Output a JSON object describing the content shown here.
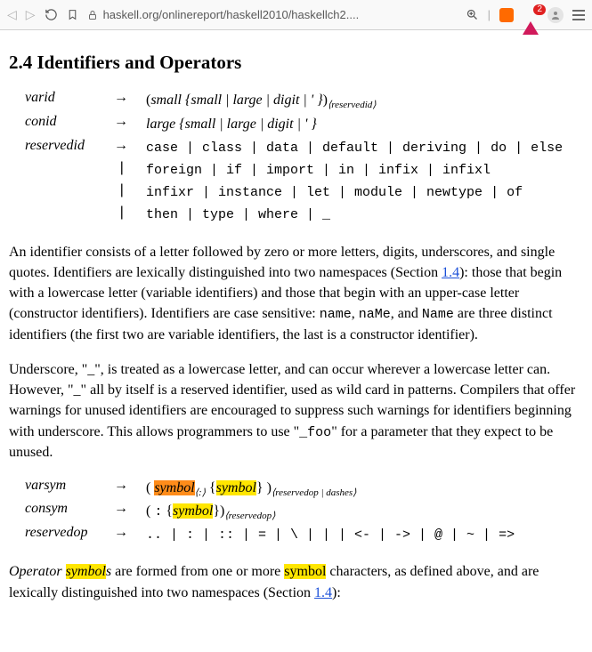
{
  "toolbar": {
    "url": "haskell.org/onlinereport/haskell2010/haskellch2....",
    "badge_count": "2"
  },
  "heading": "2.4 Identifiers and Operators",
  "grammar1": {
    "varid": {
      "lhs": "varid",
      "rhs_open": "(",
      "rhs_small": "small",
      "rhs_brace_open": " {",
      "rhs_alt": "small | large | digit",
      "rhs_tick": " | ' }",
      "rhs_close": ")",
      "rhs_sub": "⟨reservedid⟩"
    },
    "conid": {
      "lhs": "conid",
      "rhs_large": "large",
      "rhs_brace": " {small | large | digit | ' }"
    },
    "reservedid": {
      "lhs": "reservedid",
      "line1": "case | class | data | default | deriving | do | else",
      "line2": "foreign | if | import | in | infix | infixl",
      "line3": "infixr | instance | let | module | newtype | of",
      "line4": "then | type | where | _"
    }
  },
  "para1": {
    "t1": "An identifier consists of a letter followed by zero or more letters, digits, underscores, and single quotes. Identifiers are lexically distinguished into two namespaces (Section ",
    "link1": "1.4",
    "t2": "): those that begin with a lowercase letter (variable identifiers) and those that begin with an upper-case letter (constructor identifiers). Identifiers are case sensitive: ",
    "c1": "name",
    "t3": ", ",
    "c2": "naMe",
    "t4": ", and ",
    "c3": "Name",
    "t5": " are three distinct identifiers (the first two are variable identifiers, the last is a constructor identifier)."
  },
  "para2": {
    "t1": "Underscore, \"_\", is treated as a lowercase letter, and can occur wherever a lowercase letter can. However, \"_\" all by itself is a reserved identifier, used as wild card in patterns. Compilers that offer warnings for unused identifiers are encouraged to suppress such warnings for identifiers beginning with underscore. This allows programmers to use \"",
    "c1": "_foo",
    "t2": "\" for a parameter that they expect to be unused."
  },
  "grammar2": {
    "varsym": {
      "lhs": "varsym",
      "open": "( ",
      "sym1": "symbol",
      "sub1": "⟨:⟩",
      "brace_open": " {",
      "sym2": "symbol",
      "brace_close": "} )",
      "sub2": "⟨reservedop | dashes⟩"
    },
    "consym": {
      "lhs": "consym",
      "open": "( ",
      "colon": ":",
      "brace_open": " {",
      "sym": "symbol",
      "brace_close": "})",
      "sub": "⟨reservedop⟩"
    },
    "reservedop": {
      "lhs": "reservedop",
      "rhs": ".. | : | :: | = | \\ | | | <- | -> | @ | ~ | =>"
    }
  },
  "para3": {
    "t1": "Operator ",
    "h1": "symbol",
    "t1b": "s",
    "t2": " are formed from one or more ",
    "h2": "symbol",
    "t3": " characters, as defined above, and are lexically distinguished into two namespaces (Section ",
    "link": "1.4",
    "t4": "):"
  }
}
